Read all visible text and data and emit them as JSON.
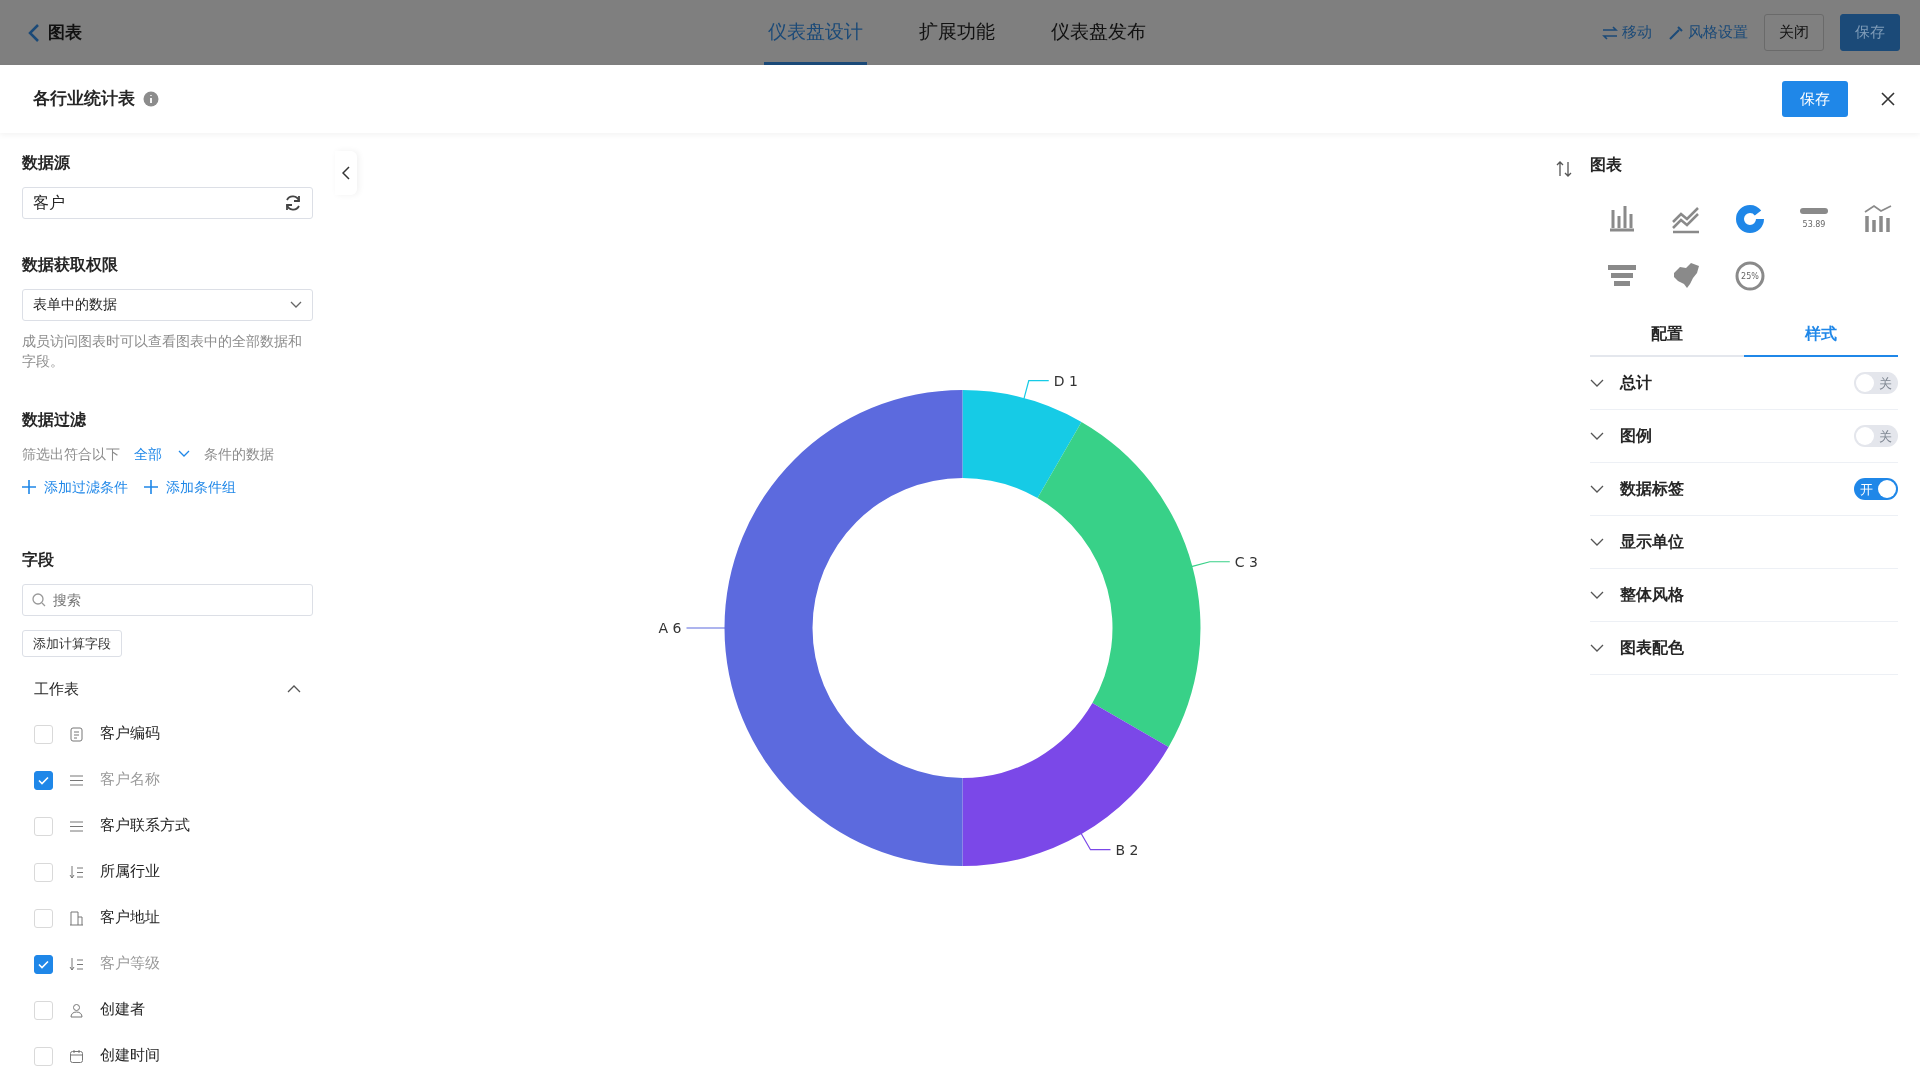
{
  "top_bar": {
    "back_label": "图表",
    "tabs": [
      {
        "label": "仪表盘设计",
        "selected": true
      },
      {
        "label": "扩展功能",
        "selected": false
      },
      {
        "label": "仪表盘发布",
        "selected": false
      }
    ],
    "actions": [
      {
        "kind": "move",
        "label": "移动"
      },
      {
        "kind": "style",
        "label": "风格设置"
      }
    ],
    "buttons": [
      {
        "label": "关闭",
        "kind": "secondary"
      },
      {
        "label": "保存",
        "kind": "primary"
      }
    ]
  },
  "modal": {
    "title": "各行业统计表",
    "save_label": "保存"
  },
  "left_panel": {
    "data_source": {
      "label": "数据源",
      "value": "客户"
    },
    "permission": {
      "label": "数据获取权限",
      "value": "表单中的数据",
      "note": "成员访问图表时可以查看图表中的全部数据和字段。"
    },
    "filter": {
      "label": "数据过滤",
      "prefix": "筛选出符合以下",
      "match": "全部",
      "suffix": "条件的数据",
      "add_actions": [
        "添加过滤条件",
        "添加条件组"
      ]
    },
    "fields": {
      "label": "字段",
      "search_placeholder": "搜索",
      "add_calc_label": "添加计算字段",
      "group": {
        "name": "工作表",
        "expanded": true,
        "items": [
          {
            "name": "客户编码",
            "kind": "serial",
            "checked": false
          },
          {
            "name": "客户名称",
            "kind": "text",
            "checked": true
          },
          {
            "name": "客户联系方式",
            "kind": "text",
            "checked": false
          },
          {
            "name": "所属行业",
            "kind": "select",
            "checked": false
          },
          {
            "name": "客户地址",
            "kind": "address",
            "checked": false
          },
          {
            "name": "客户等级",
            "kind": "select",
            "checked": true
          },
          {
            "name": "创建者",
            "kind": "user",
            "checked": false
          },
          {
            "name": "创建时间",
            "kind": "date",
            "checked": false
          }
        ]
      }
    }
  },
  "chart_area": {
    "chart_data": {
      "type": "donut",
      "categories": [
        "D 1",
        "C 3",
        "B 2",
        "A 6"
      ],
      "values": [
        1,
        3,
        2,
        6
      ]
    }
  },
  "right_panel": {
    "title": "图表",
    "chart_types": [
      {
        "kind": "bar",
        "selected": false
      },
      {
        "kind": "line",
        "selected": false
      },
      {
        "kind": "donut",
        "selected": true
      },
      {
        "kind": "number",
        "selected": false,
        "caption": "53.89"
      },
      {
        "kind": "combo",
        "selected": false
      },
      {
        "kind": "funnel",
        "selected": false
      },
      {
        "kind": "map",
        "selected": false
      },
      {
        "kind": "gauge",
        "selected": false,
        "caption": "25%"
      }
    ],
    "tabs": [
      {
        "label": "配置",
        "selected": false
      },
      {
        "label": "样式",
        "selected": true
      }
    ],
    "sections": [
      {
        "label": "总计",
        "toggle": {
          "on": false,
          "text": "关"
        }
      },
      {
        "label": "图例",
        "toggle": {
          "on": false,
          "text": "关"
        }
      },
      {
        "label": "数据标签",
        "toggle": {
          "on": true,
          "text": "开"
        }
      },
      {
        "label": "显示单位"
      },
      {
        "label": "整体风格"
      },
      {
        "label": "图表配色"
      }
    ]
  }
}
